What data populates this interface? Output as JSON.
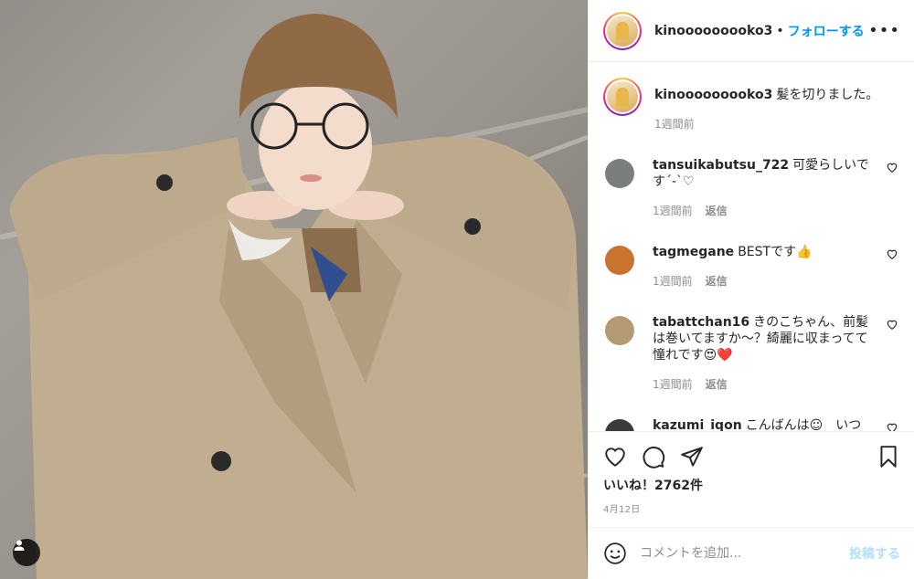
{
  "header": {
    "username": "kinooooooooko3",
    "separator": "•",
    "follow_label": "フォローする",
    "more_label": "•••"
  },
  "caption": {
    "username": "kinooooooooko3",
    "text": "髪を切りました。",
    "time": "1週間前"
  },
  "comments": [
    {
      "username": "tansuikabutsu_722",
      "text": "可愛らしいです´-`♡",
      "time": "1週間前",
      "reply_label": "返信",
      "avatar_color": "#7a7f7b"
    },
    {
      "username": "tagmegane",
      "text": "BESTです👍",
      "time": "1週間前",
      "reply_label": "返信",
      "avatar_color": "#c8742e"
    },
    {
      "username": "tabattchan16",
      "text": "きのこちゃん、前髪は巻いてますか〜？綺麗に収まってて憧れです😍❤️",
      "time": "1週間前",
      "reply_label": "返信",
      "avatar_color": "#b49a73"
    },
    {
      "username": "kazumi_iqon",
      "text": "こんばんは☺︎　いつ",
      "time": "",
      "reply_label": "",
      "avatar_color": "#3a3a3a"
    }
  ],
  "likes": {
    "label": "いいね！2762件"
  },
  "date": "4月12日",
  "add_comment": {
    "placeholder": "コメントを追加...",
    "post_label": "投稿する"
  },
  "icons": {
    "more": "more-icon",
    "heart": "heart-icon",
    "comment": "comment-icon",
    "share": "share-icon",
    "save": "bookmark-icon",
    "emoji": "emoji-icon",
    "user_tag": "user-icon"
  },
  "colors": {
    "follow": "#0095f6",
    "post_disabled": "#b2dffc",
    "meta": "#8e8e8e",
    "border": "#efefef"
  }
}
